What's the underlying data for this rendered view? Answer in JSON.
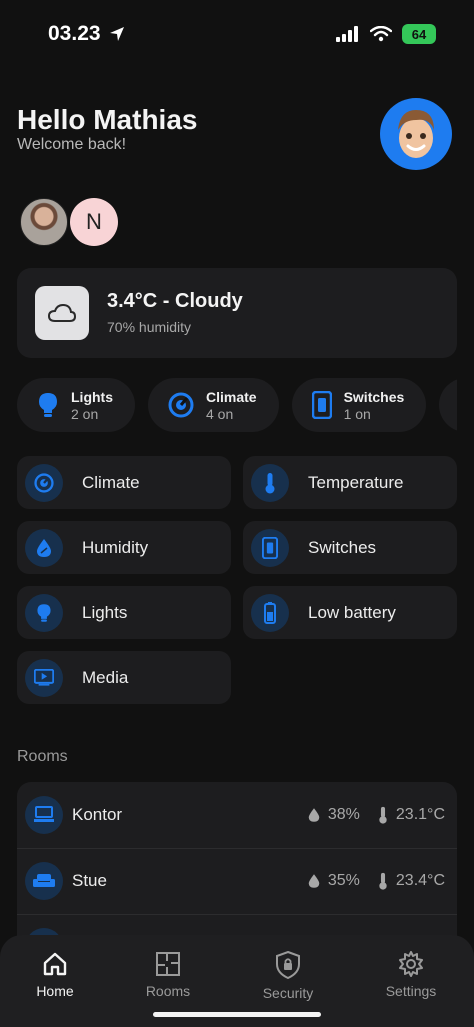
{
  "status": {
    "time": "03.23",
    "battery": "64"
  },
  "header": {
    "greeting": "Hello Mathias",
    "welcome": "Welcome back!"
  },
  "people": {
    "initial": "N"
  },
  "weather": {
    "title": "3.4°C - Cloudy",
    "humidity": "70% humidity"
  },
  "chips": [
    {
      "title": "Lights",
      "sub": "2 on",
      "icon": "lightbulb-icon"
    },
    {
      "title": "Climate",
      "sub": "4 on",
      "icon": "thermostat-icon"
    },
    {
      "title": "Switches",
      "sub": "1 on",
      "icon": "switch-icon"
    },
    {
      "title": "",
      "sub": "",
      "icon": "media-icon"
    }
  ],
  "tiles": [
    {
      "label": "Climate",
      "icon": "thermostat-icon"
    },
    {
      "label": "Temperature",
      "icon": "thermometer-icon"
    },
    {
      "label": "Humidity",
      "icon": "humidity-icon"
    },
    {
      "label": "Switches",
      "icon": "switch-icon"
    },
    {
      "label": "Lights",
      "icon": "lightbulb-icon"
    },
    {
      "label": "Low battery",
      "icon": "battery-icon"
    },
    {
      "label": "Media",
      "icon": "media-icon"
    }
  ],
  "rooms": {
    "title": "Rooms",
    "items": [
      {
        "name": "Kontor",
        "humidity": "38%",
        "temperature": "23.1°C",
        "icon": "desk-icon"
      },
      {
        "name": "Stue",
        "humidity": "35%",
        "temperature": "23.4°C",
        "icon": "sofa-icon"
      }
    ]
  },
  "nav": [
    {
      "label": "Home",
      "icon": "home-icon",
      "active": true
    },
    {
      "label": "Rooms",
      "icon": "floorplan-icon",
      "active": false
    },
    {
      "label": "Security",
      "icon": "shield-icon",
      "active": false
    },
    {
      "label": "Settings",
      "icon": "gear-icon",
      "active": false
    }
  ],
  "colors": {
    "accent": "#1e7cf0",
    "background": "#111111",
    "card": "#1d1d1f",
    "icon_bg": "#17304d"
  }
}
